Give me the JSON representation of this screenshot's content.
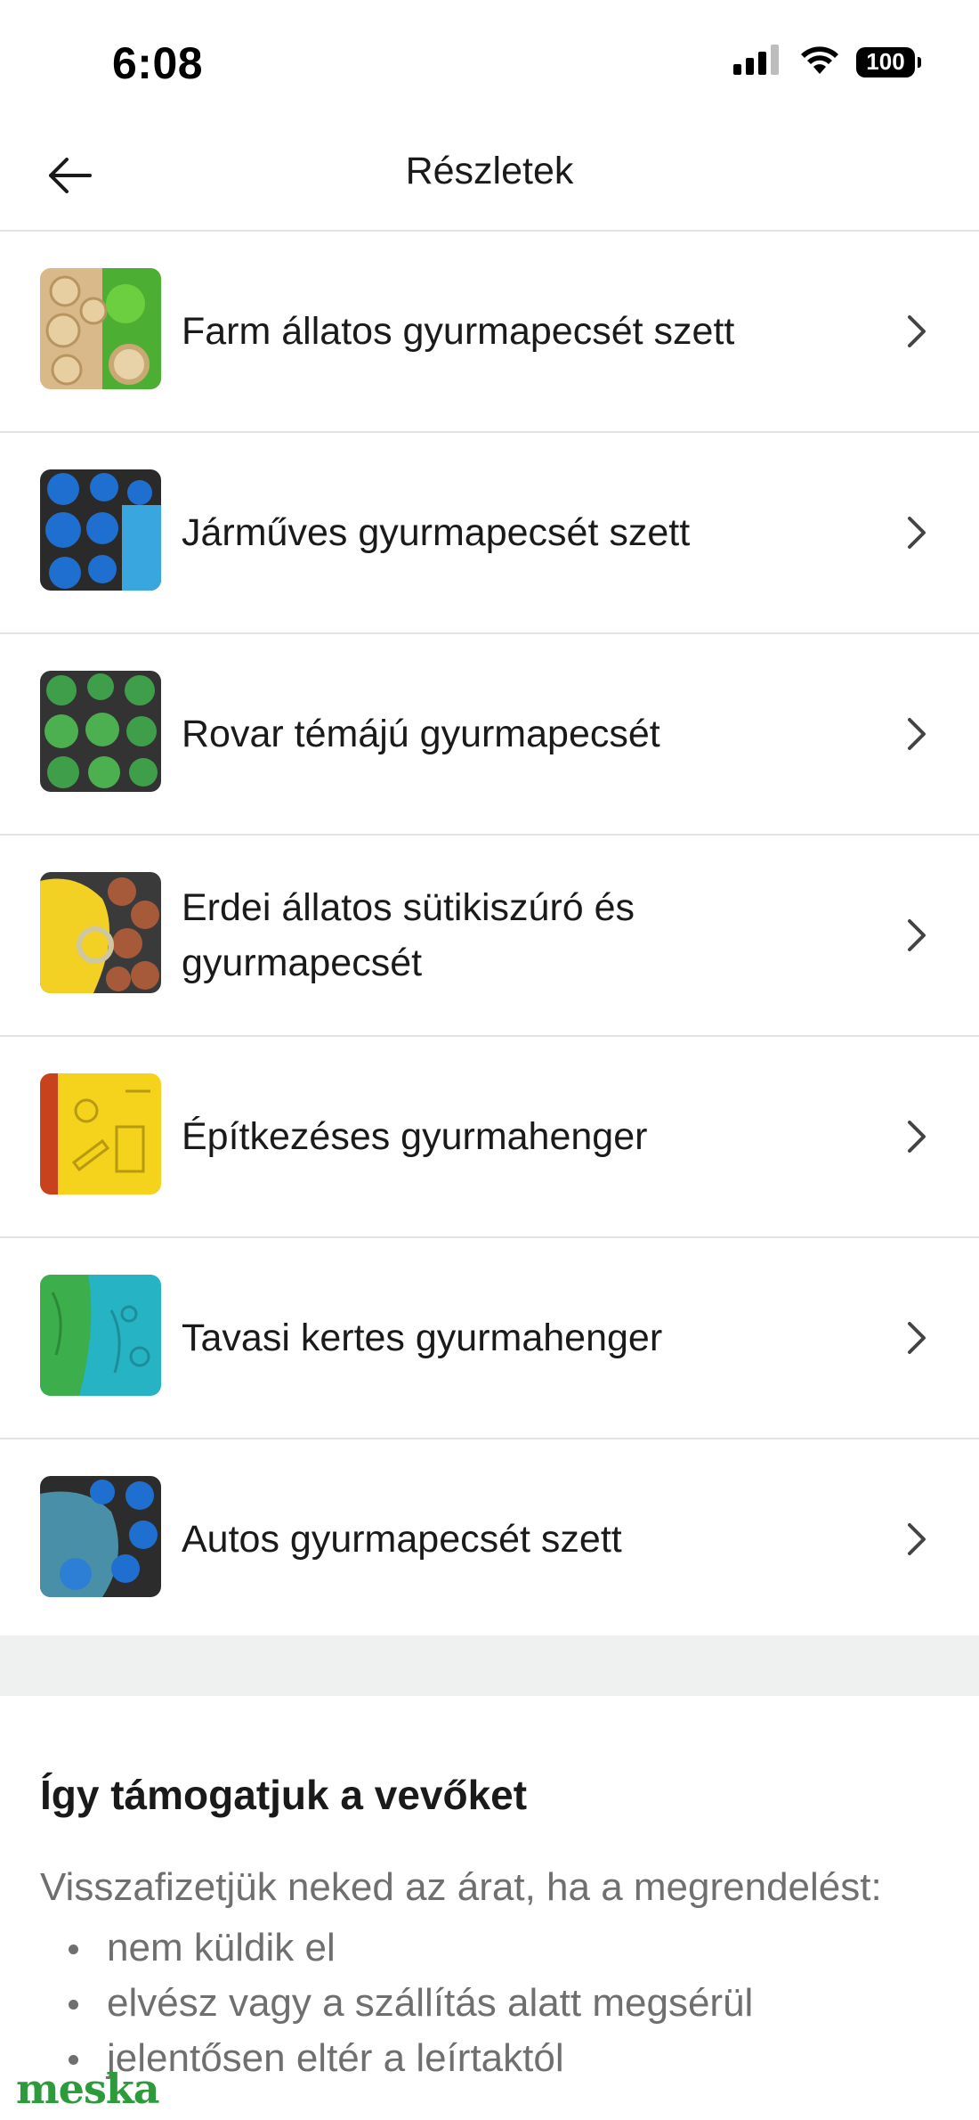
{
  "status_bar": {
    "time": "6:08",
    "battery": "100",
    "icons": [
      "signal-icon",
      "wifi-icon",
      "battery-icon"
    ]
  },
  "header": {
    "back_icon": "arrow-left-icon",
    "title": "Részletek"
  },
  "items": [
    {
      "label": "Farm állatos gyurmapecsét szett",
      "thumb": "farm-stamps"
    },
    {
      "label": "Járműves gyurmapecsét szett",
      "thumb": "vehicle-stamps"
    },
    {
      "label": "Rovar témájú gyurmapecsét",
      "thumb": "insect-stamps"
    },
    {
      "label": "Erdei állatos sütikiszúró és gyurmapecsét",
      "thumb": "forest-stamps"
    },
    {
      "label": "Építkezéses gyurmahenger",
      "thumb": "construction-roller"
    },
    {
      "label": "Tavasi kertes gyurmahenger",
      "thumb": "garden-roller"
    },
    {
      "label": "Autos gyurmapecsét szett",
      "thumb": "car-stamps"
    }
  ],
  "support": {
    "title": "Így támogatjuk a vevőket",
    "intro": "Visszafizetjük neked az árat, ha a megrendelést:",
    "bullets": [
      "nem küldik el",
      "elvész vagy a szállítás alatt megsérül",
      "jelentősen eltér a leírtaktól"
    ]
  },
  "watermark": "meska",
  "colors": {
    "divider": "#e3e3e3",
    "band": "#eff1f1",
    "muted_text": "#6f6f6f",
    "brand_green": "#2d9a3c"
  }
}
